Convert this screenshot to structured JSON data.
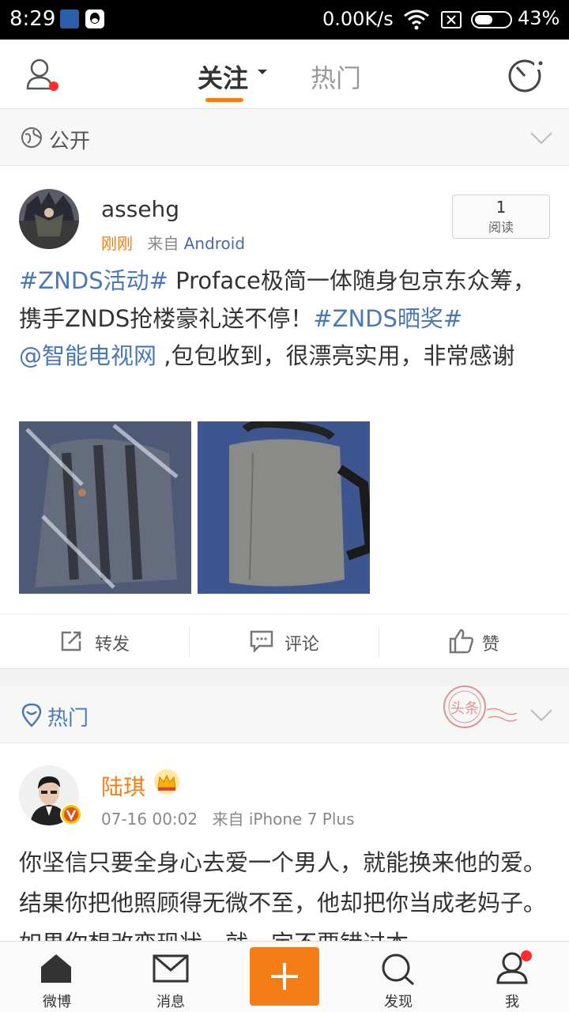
{
  "status_bar": {
    "time": "8:29",
    "network_speed": "0.00K/s",
    "battery": "43%"
  },
  "top_nav": {
    "tabs": [
      {
        "label": "关注"
      },
      {
        "label": "热门"
      }
    ]
  },
  "section_public": {
    "label": "公开"
  },
  "post1": {
    "username": "assehg",
    "time": "刚刚",
    "source_prefix": "来自",
    "source": "Android",
    "read_count": "1",
    "read_label": "阅读",
    "text_parts": {
      "tag1": "#ZNDS活动#",
      "body1": " Proface极简一体随身包京东众筹，携手ZNDS抢楼豪礼送不停！",
      "tag2": "#ZNDS晒奖#",
      "mention": "@智能电视网",
      "body2": " ,包包收到，很漂亮实用，非常感谢"
    }
  },
  "actions": {
    "repost": "转发",
    "comment": "评论",
    "like": "赞"
  },
  "section_hot": {
    "label": "热门",
    "stamp": "头条"
  },
  "post2": {
    "username": "陆琪",
    "time": "07-16 00:02",
    "source_prefix": "来自",
    "source": "iPhone 7 Plus",
    "text": "你坚信只要全身心去爱一个男人，就能换来他的爱。结果你把他照顾得无微不至，他却把你当成老妈子。如果你想改变现状，就一定不要错过本"
  },
  "tab_bar": {
    "items": [
      {
        "label": "微博"
      },
      {
        "label": "消息"
      },
      {
        "label": "发现"
      },
      {
        "label": "我"
      }
    ]
  },
  "colors": {
    "accent": "#f57d16",
    "link": "#4a78b5",
    "notify": "#ff2d2d"
  }
}
